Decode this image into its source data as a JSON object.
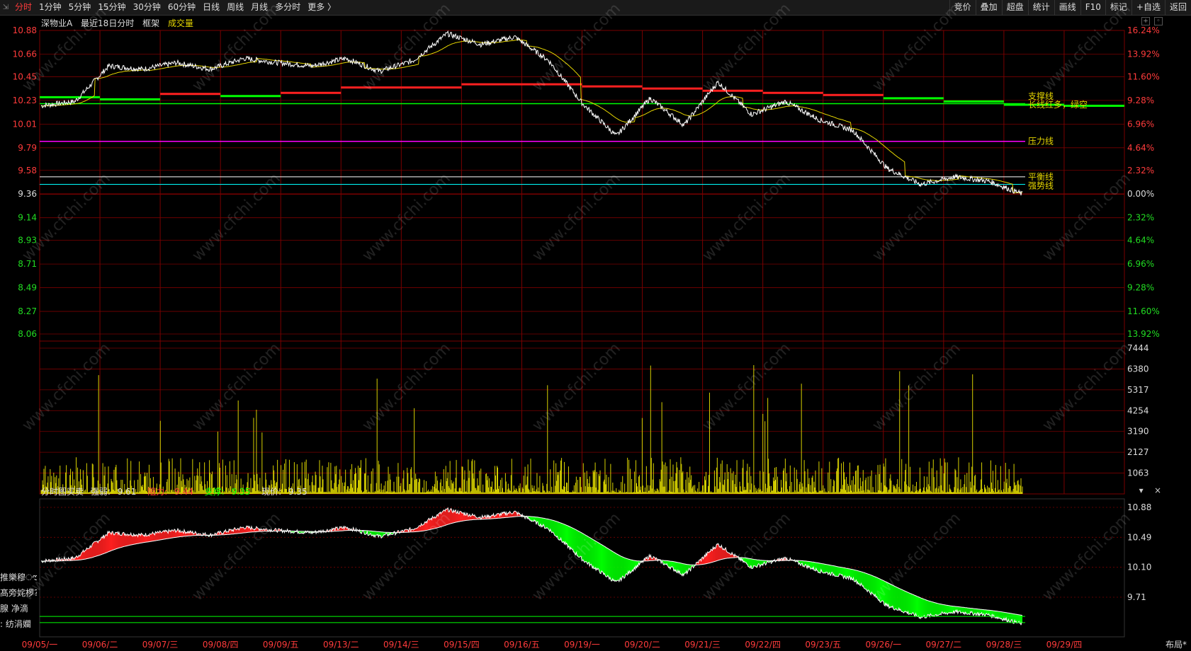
{
  "topbar": {
    "tabs": [
      "分时",
      "1分钟",
      "5分钟",
      "15分钟",
      "30分钟",
      "60分钟",
      "日线",
      "周线",
      "月线",
      "多分时",
      "更多 〉"
    ],
    "active_tab": 0,
    "right_buttons": [
      "竞价",
      "叠加",
      "超盘",
      "统计",
      "画线",
      "F10",
      "标记",
      "+自选",
      "返回"
    ]
  },
  "header": {
    "stock": "深物业A",
    "period": "最近18日分时",
    "frame": "框架",
    "volume_label": "成交量"
  },
  "price_axis": {
    "left_ticks": [
      "10.88",
      "10.66",
      "10.45",
      "10.23",
      "10.01",
      "9.79",
      "9.58",
      "9.36",
      "9.14",
      "8.93",
      "8.71",
      "8.49",
      "8.27",
      "8.06"
    ],
    "right_ticks": [
      "16.24%",
      "13.92%",
      "11.60%",
      "9.28%",
      "6.96%",
      "4.64%",
      "2.32%",
      "0.00%",
      "2.32%",
      "4.64%",
      "6.96%",
      "9.28%",
      "11.60%",
      "13.92%"
    ]
  },
  "volume_axis": {
    "ticks": [
      "7444",
      "6380",
      "5317",
      "4254",
      "3190",
      "2127",
      "1063"
    ]
  },
  "line_labels": {
    "support": "支撑线",
    "long_term": "长线红多，绿空",
    "pressure": "压力线",
    "balance": "平衡线",
    "strong": "强势线"
  },
  "indicator": {
    "title": "分时图买卖",
    "strength_label": "强弱:",
    "strength_value": "9.61",
    "resistance_label": "阻力:",
    "resistance_value": "9.44",
    "support_label": "支撑:",
    "support_value": "9.35",
    "price_label": "现价:",
    "price_value": "9.35",
    "ticks": [
      "10.88",
      "10.49",
      "10.10",
      "9.71"
    ],
    "close_glyph": "×",
    "menu_glyph": "▾"
  },
  "side_labels": [
    "推樂穆ൗ",
    "髙旁姹椤?",
    "腺  净滴",
    ":  纺涓孄"
  ],
  "dates": [
    "09/05/一",
    "09/06/二",
    "09/07/三",
    "09/08/四",
    "09/09/五",
    "09/13/二",
    "09/14/三",
    "09/15/四",
    "09/16/五",
    "09/19/一",
    "09/20/二",
    "09/21/三",
    "09/22/四",
    "09/23/五",
    "09/26/一",
    "09/27/二",
    "09/28/三",
    "09/29/四"
  ],
  "layout_button": "布局*",
  "watermark": "www.cfchi.com",
  "colors": {
    "grid": "#7a0000",
    "up": "#ff2020",
    "down": "#00ff00",
    "price_line": "#ffffff",
    "avg_line": "#e6d600",
    "pressure": "#ff00ff",
    "balance": "#ffffff",
    "strong": "#00ffff"
  },
  "chart_data": {
    "type": "line",
    "title": "深物业A 最近18日分时",
    "days": [
      "09/05",
      "09/06",
      "09/07",
      "09/08",
      "09/09",
      "09/13",
      "09/14",
      "09/15",
      "09/16",
      "09/19",
      "09/20",
      "09/21",
      "09/22",
      "09/23",
      "09/26",
      "09/27",
      "09/28",
      "09/29"
    ],
    "price_keypoints": [
      10.18,
      10.22,
      10.55,
      10.52,
      10.58,
      10.52,
      10.62,
      10.58,
      10.55,
      10.62,
      10.5,
      10.6,
      10.85,
      10.75,
      10.82,
      10.6,
      10.2,
      9.9,
      10.25,
      10.0,
      10.4,
      10.1,
      10.22,
      10.05,
      9.95,
      9.6,
      9.45,
      9.52,
      9.48,
      9.36
    ],
    "reference_price": 9.36,
    "support_segments": [
      10.26,
      10.24,
      10.29,
      10.27,
      10.3,
      10.35,
      10.35,
      10.38,
      10.38,
      10.36,
      10.34,
      10.32,
      10.3,
      10.28,
      10.25,
      10.22,
      10.19,
      10.18
    ],
    "pressure_line": 9.85,
    "balance_line": 9.52,
    "strong_line": 9.45,
    "long_line": 10.2,
    "volume_max": 7444
  }
}
